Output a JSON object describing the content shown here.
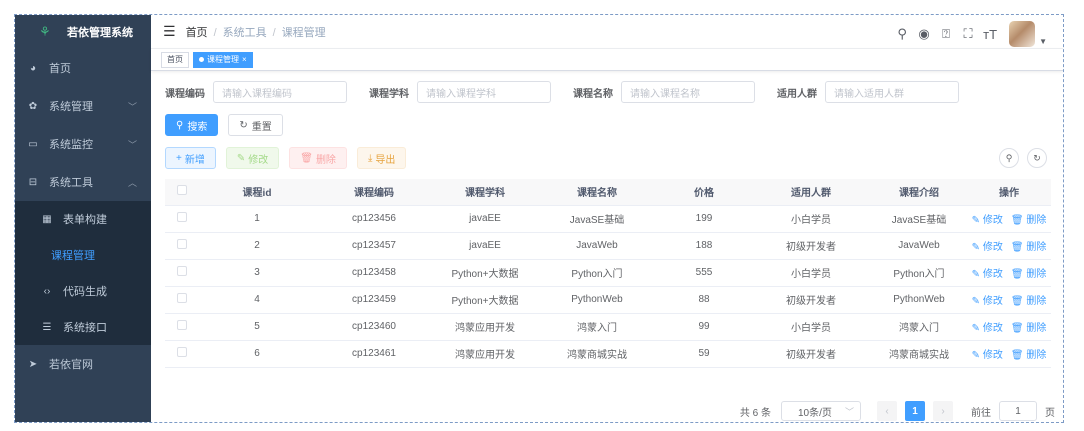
{
  "app": {
    "title": "若依管理系统"
  },
  "sidebar": {
    "items": [
      {
        "label": "首页",
        "icon": "dashboard-icon"
      },
      {
        "label": "系统管理",
        "icon": "gear-icon"
      },
      {
        "label": "系统监控",
        "icon": "monitor-icon"
      },
      {
        "label": "系统工具",
        "icon": "toolbox-icon"
      }
    ],
    "sub": [
      {
        "label": "表单构建",
        "icon": "form-icon"
      },
      {
        "label": "课程管理",
        "icon": ""
      },
      {
        "label": "代码生成",
        "icon": "code-icon"
      },
      {
        "label": "系统接口",
        "icon": "api-icon"
      }
    ],
    "site": {
      "label": "若依官网",
      "icon": "send-icon"
    }
  },
  "navbar": {
    "breadcrumb": [
      "首页",
      "系统工具",
      "课程管理"
    ]
  },
  "tags": {
    "home": "首页",
    "current": "课程管理"
  },
  "search": {
    "code": {
      "label": "课程编码",
      "placeholder": "请输入课程编码"
    },
    "subject": {
      "label": "课程学科",
      "placeholder": "请输入课程学科"
    },
    "name": {
      "label": "课程名称",
      "placeholder": "请输入课程名称"
    },
    "group": {
      "label": "适用人群",
      "placeholder": "请输入适用人群"
    },
    "search_btn": "搜索",
    "reset_btn": "重置"
  },
  "toolbar": {
    "add": "新增",
    "edit": "修改",
    "delete": "删除",
    "export": "导出"
  },
  "table": {
    "headers": [
      "课程id",
      "课程编码",
      "课程学科",
      "课程名称",
      "价格",
      "适用人群",
      "课程介绍",
      "操作"
    ],
    "edit_label": "修改",
    "delete_label": "删除",
    "rows": [
      [
        "1",
        "cp123456",
        "javaEE",
        "JavaSE基础",
        "199",
        "小白学员",
        "JavaSE基础"
      ],
      [
        "2",
        "cp123457",
        "javaEE",
        "JavaWeb",
        "188",
        "初级开发者",
        "JavaWeb"
      ],
      [
        "3",
        "cp123458",
        "Python+大数据",
        "Python入门",
        "555",
        "小白学员",
        "Python入门"
      ],
      [
        "4",
        "cp123459",
        "Python+大数据",
        "PythonWeb",
        "88",
        "初级开发者",
        "PythonWeb"
      ],
      [
        "5",
        "cp123460",
        "鸿蒙应用开发",
        "鸿蒙入门",
        "99",
        "小白学员",
        "鸿蒙入门"
      ],
      [
        "6",
        "cp123461",
        "鸿蒙应用开发",
        "鸿蒙商城实战",
        "59",
        "初级开发者",
        "鸿蒙商城实战"
      ]
    ]
  },
  "pagination": {
    "total": "共 6 条",
    "page_size": "10条/页",
    "current": "1",
    "goto_label": "前往",
    "goto_value": "1",
    "page_suffix": "页"
  },
  "colors": {
    "sidebar": "#304156",
    "primary": "#409eff"
  }
}
